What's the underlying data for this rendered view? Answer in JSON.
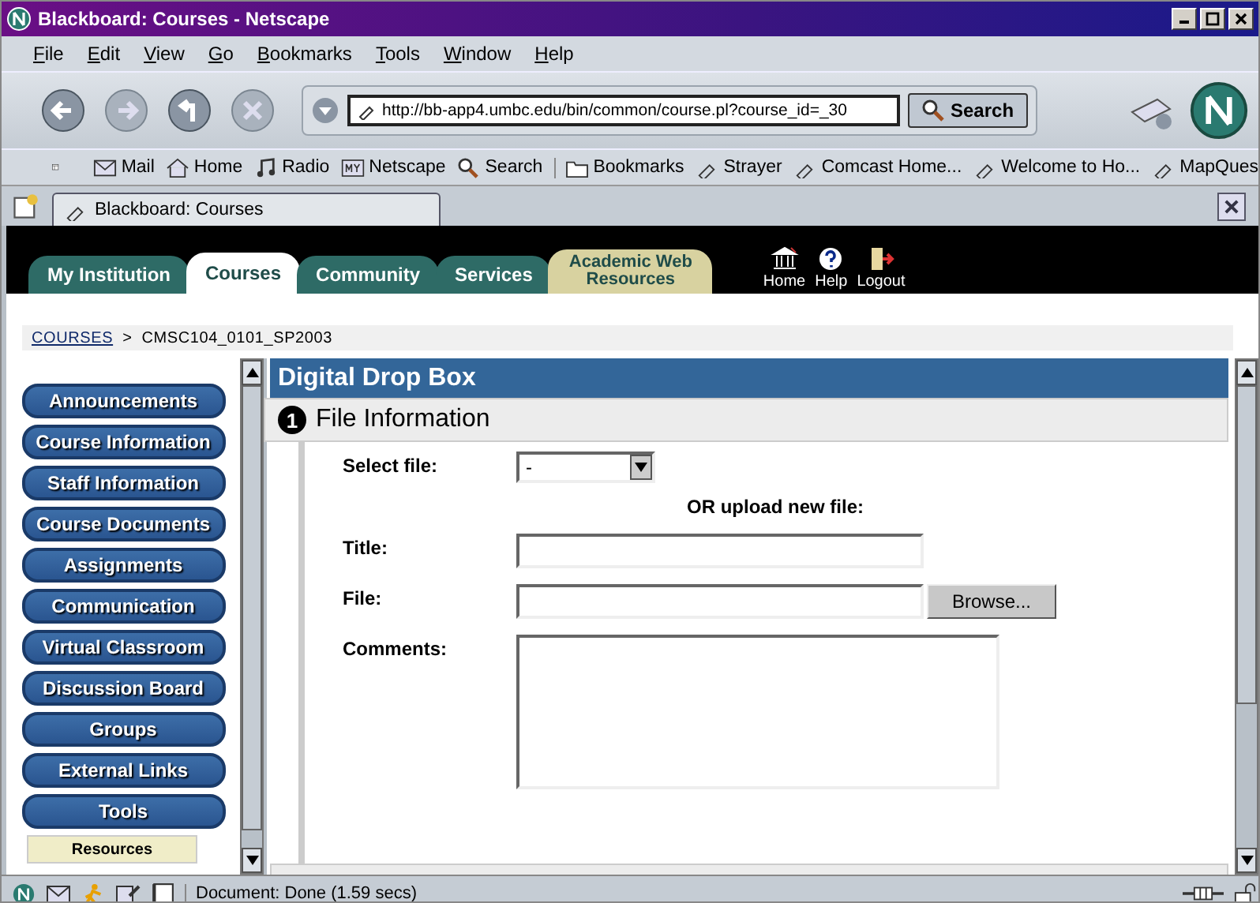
{
  "window": {
    "title": "Blackboard: Courses - Netscape"
  },
  "menu": [
    "File",
    "Edit",
    "View",
    "Go",
    "Bookmarks",
    "Tools",
    "Window",
    "Help"
  ],
  "address": {
    "value": "http://bb-app4.umbc.edu/bin/common/course.pl?course_id=_30"
  },
  "search_button": "Search",
  "personal_bar": [
    {
      "label": "Mail",
      "kind": "mail"
    },
    {
      "label": "Home",
      "kind": "home"
    },
    {
      "label": "Radio",
      "kind": "radio"
    },
    {
      "label": "Netscape",
      "kind": "my"
    },
    {
      "label": "Search",
      "kind": "search"
    },
    {
      "label": "Bookmarks",
      "kind": "folder"
    },
    {
      "label": "Strayer",
      "kind": "bookmark"
    },
    {
      "label": "Comcast Home...",
      "kind": "bookmark"
    },
    {
      "label": "Welcome to Ho...",
      "kind": "bookmark"
    },
    {
      "label": "MapQues",
      "kind": "bookmark"
    }
  ],
  "browser_tabs": [
    {
      "label": "Blackboard: Courses",
      "selected": true
    }
  ],
  "site_tabs": [
    {
      "label": "My Institution",
      "selected": false,
      "kind": "normal"
    },
    {
      "label": "Courses",
      "selected": true,
      "kind": "normal"
    },
    {
      "label": "Community",
      "selected": false,
      "kind": "normal"
    },
    {
      "label": "Services",
      "selected": false,
      "kind": "normal"
    },
    {
      "label": "Academic Web Resources",
      "selected": false,
      "kind": "accent"
    }
  ],
  "header_links": [
    {
      "label": "Home",
      "kind": "home"
    },
    {
      "label": "Help",
      "kind": "help"
    },
    {
      "label": "Logout",
      "kind": "logout"
    }
  ],
  "breadcrumb": {
    "link": "COURSES",
    "separator": ">",
    "current": "CMSC104_0101_SP2003"
  },
  "nav_buttons": [
    "Announcements",
    "Course Information",
    "Staff Information",
    "Course Documents",
    "Assignments",
    "Communication",
    "Virtual Classroom",
    "Discussion Board",
    "Groups",
    "External Links",
    "Tools"
  ],
  "resources": "Resources",
  "panel": {
    "title": "Digital Drop Box",
    "section_number": "1",
    "section_title": "File Information",
    "select_label": "Select file:",
    "select_value": "-",
    "or_upload": "OR upload new file:",
    "title_label": "Title:",
    "file_label": "File:",
    "browse": "Browse...",
    "comments_label": "Comments:"
  },
  "status": "Document: Done (1.59 secs)"
}
